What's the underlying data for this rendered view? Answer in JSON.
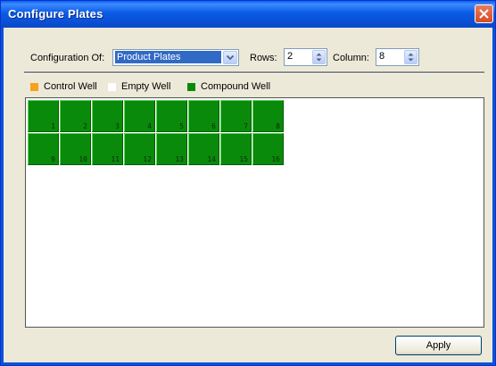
{
  "window": {
    "title": "Configure Plates"
  },
  "config": {
    "configuration_label": "Configuration Of:",
    "configuration_value": "Product Plates",
    "rows_label": "Rows:",
    "rows_value": "2",
    "column_label": "Column:",
    "column_value": "8"
  },
  "legend": [
    {
      "label": "Control Well",
      "color": "#f5a21c"
    },
    {
      "label": "Empty Well",
      "color": "#ffffff"
    },
    {
      "label": "Compound Well",
      "color": "#0a8a0a"
    }
  ],
  "wells": [
    "1",
    "2",
    "3",
    "4",
    "5",
    "6",
    "7",
    "8",
    "9",
    "10",
    "11",
    "12",
    "13",
    "14",
    "15",
    "16"
  ],
  "actions": {
    "apply_label": "Apply"
  }
}
